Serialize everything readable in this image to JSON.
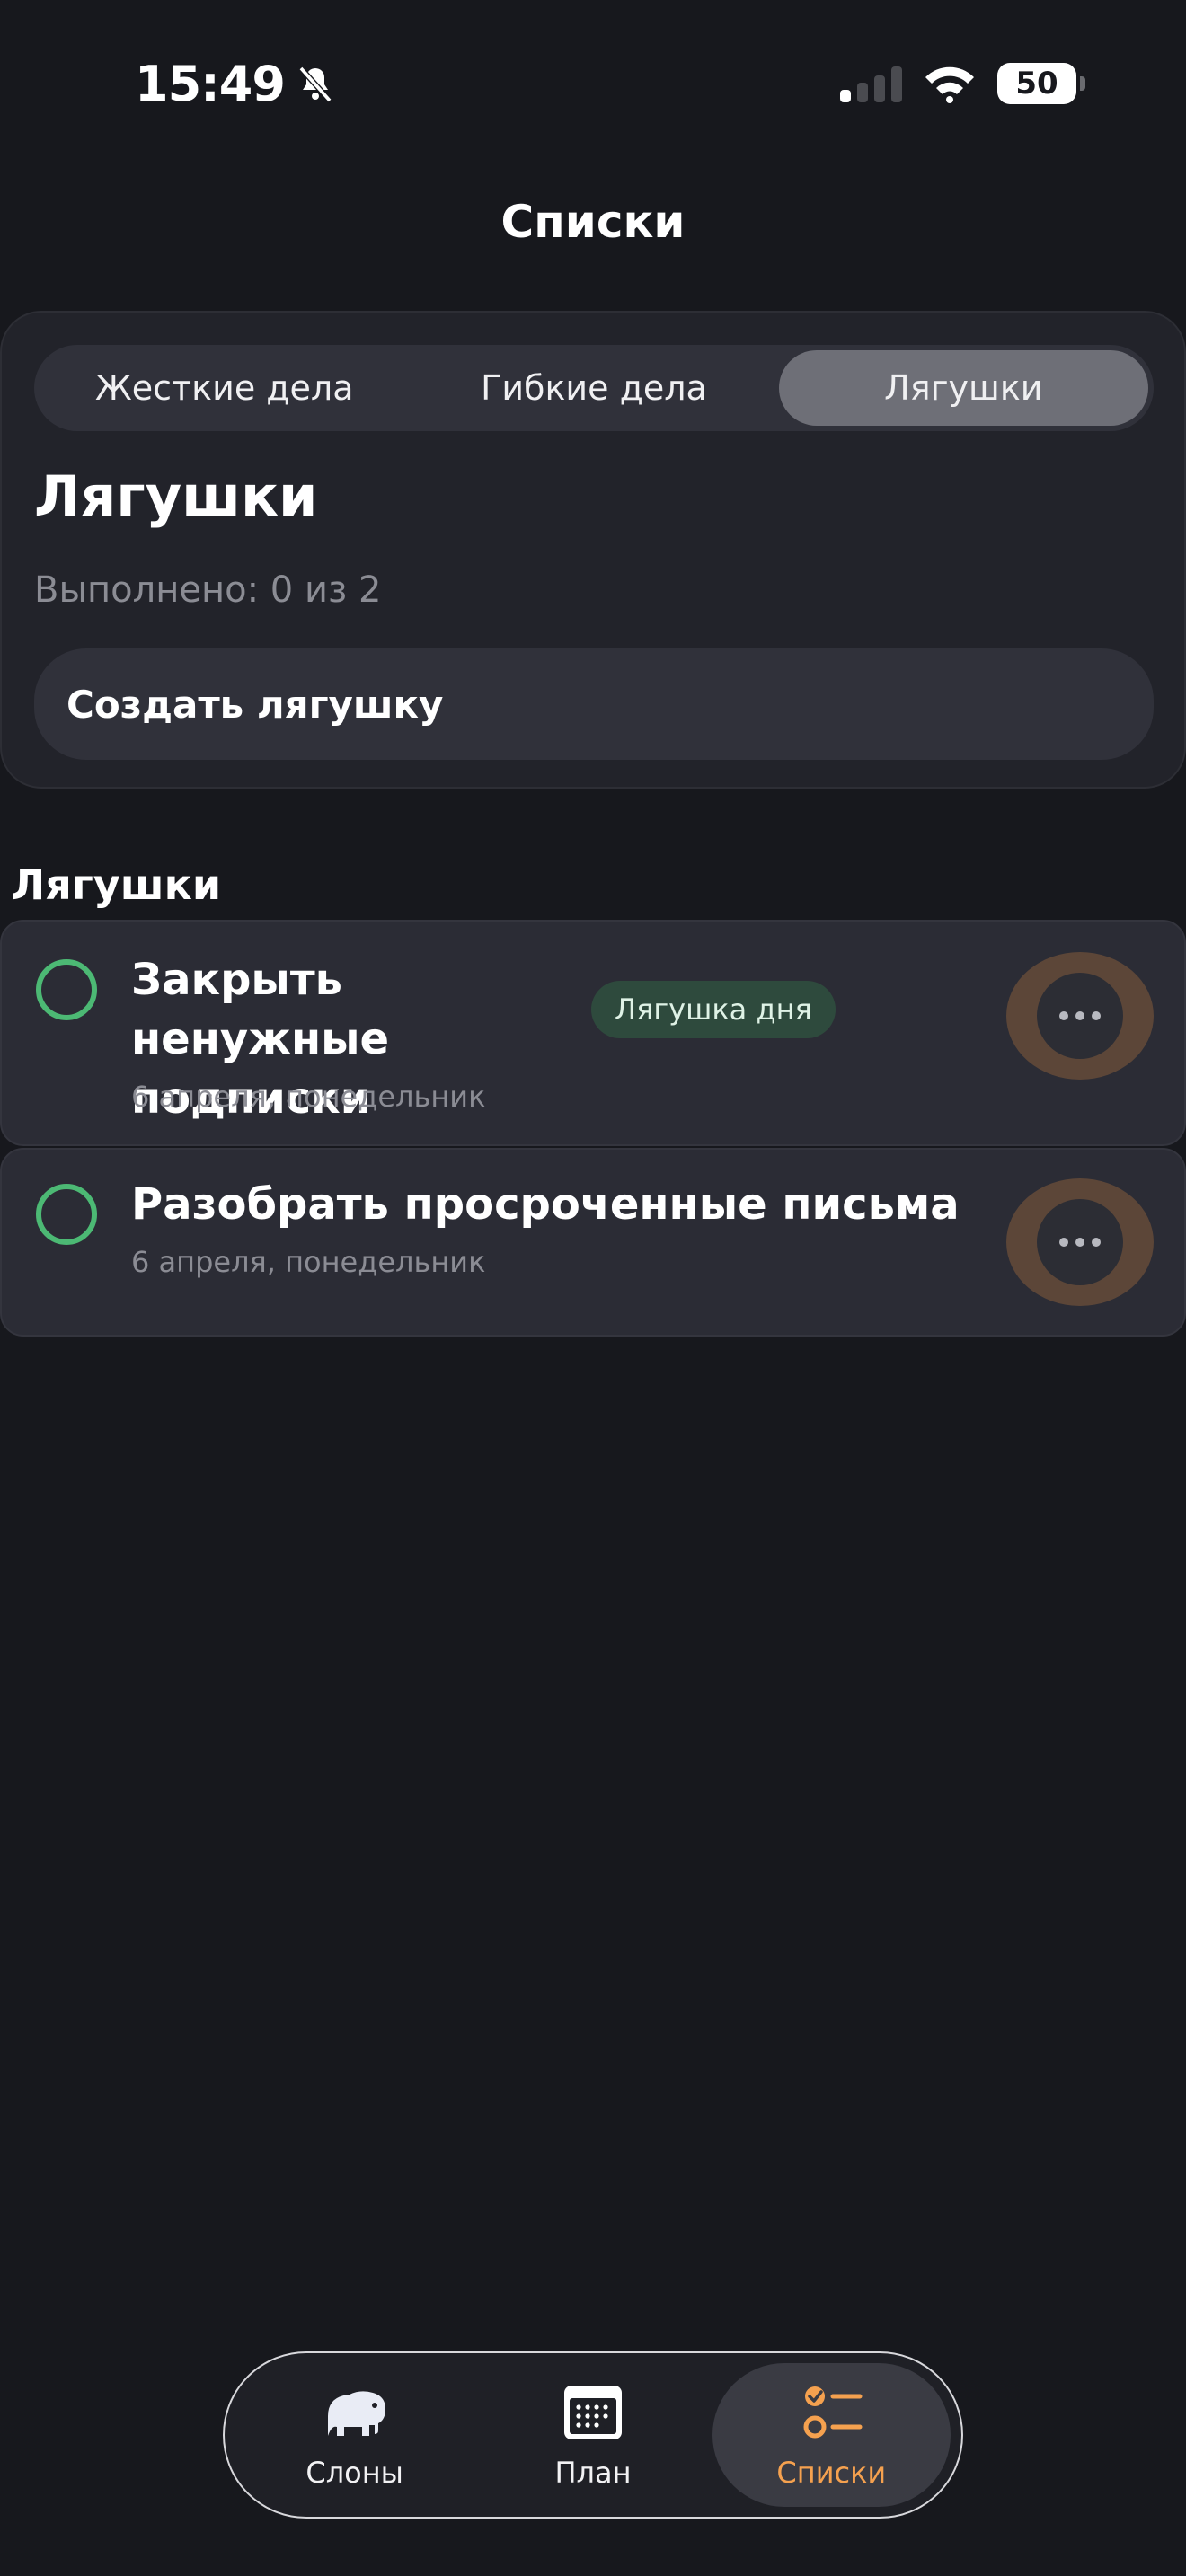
{
  "status_bar": {
    "time": "15:49",
    "battery": "50",
    "icons": [
      "bell-slash-icon",
      "cellular-signal-icon",
      "wifi-icon",
      "battery-icon"
    ]
  },
  "nav": {
    "title": "Списки"
  },
  "segments": [
    {
      "label": "Жесткие дела",
      "selected": false
    },
    {
      "label": "Гибкие дела",
      "selected": false
    },
    {
      "label": "Лягушки",
      "selected": true
    }
  ],
  "summary": {
    "title": "Лягушки",
    "progress": "Выполнено: 0 из 2",
    "create_label": "Создать лягушку"
  },
  "section": {
    "title": "Лягушки",
    "tasks": [
      {
        "title": "Закрыть ненужные подписки",
        "date": "6 апреля, понедельник",
        "badge": "Лягушка дня",
        "done": false
      },
      {
        "title": "Разобрать просроченные письма",
        "date": "6 апреля, понедельник",
        "done": false
      }
    ]
  },
  "tab_bar": {
    "items": [
      {
        "label": "Слоны",
        "icon": "elephant-icon",
        "active": false
      },
      {
        "label": "План",
        "icon": "calendar-icon",
        "active": false
      },
      {
        "label": "Списки",
        "icon": "checklist-icon",
        "active": true
      }
    ]
  },
  "colors": {
    "background": "#17181d",
    "accent": "#f5a14f",
    "check": "#4cb974",
    "badge_bg": "#2e4a3d"
  }
}
